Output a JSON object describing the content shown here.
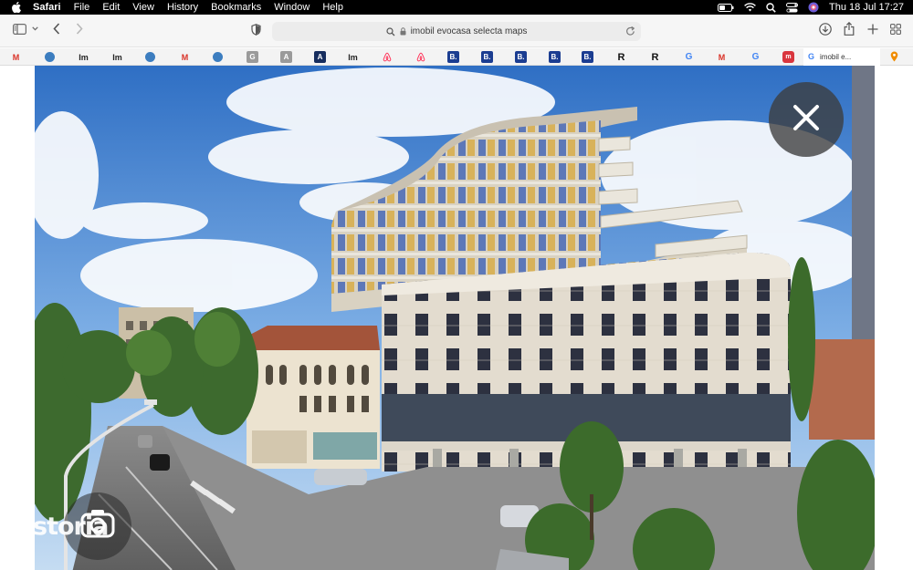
{
  "menubar": {
    "app": "Safari",
    "items": [
      "File",
      "Edit",
      "View",
      "History",
      "Bookmarks",
      "Window",
      "Help"
    ],
    "clock": "Thu 18 Jul  17:27"
  },
  "toolbar": {
    "url": "imobil evocasa selecta maps"
  },
  "favorites": {
    "active_tab_label": "imobil e...",
    "items": [
      "M",
      "",
      "Im",
      "Im",
      "",
      "M",
      "",
      "G",
      "A",
      "A",
      "Im",
      "",
      "",
      "B.",
      "B.",
      "B.",
      "B.",
      "B.",
      "R",
      "R",
      "G",
      "M",
      "G",
      "m"
    ]
  },
  "photo": {
    "watermark": "storia"
  }
}
